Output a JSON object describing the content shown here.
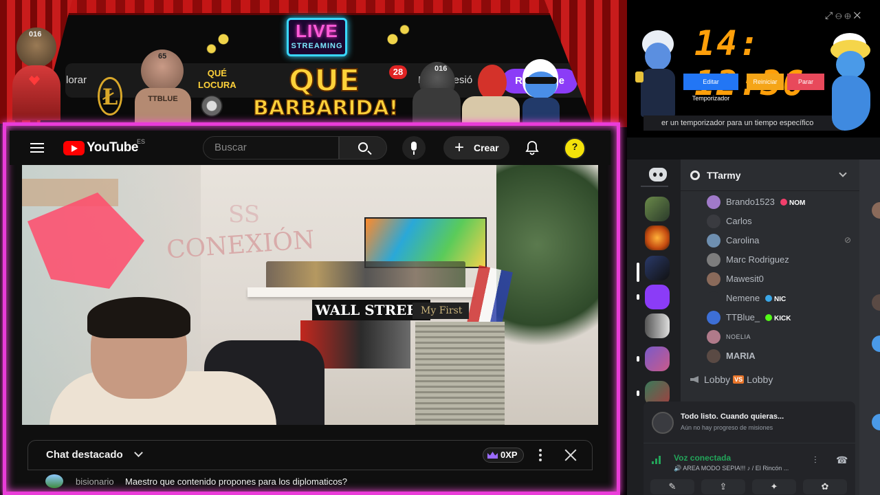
{
  "overlay": {
    "live_line1": "LIVE",
    "live_line2": "STREAMING",
    "que_locura_1": "QUÉ",
    "que_locura_2": "LOCURA",
    "headline_1": "QUE",
    "headline_2": "BARBARIDA!",
    "cat_label": "016",
    "man_label": "65",
    "man_shirt": "TTBLUE",
    "robot_label": "016",
    "ghost_explore": "lorar",
    "ghost_signin": "Iniciar sesió",
    "ghost_signin2": "Re",
    "ghost_signin3": "se",
    "notification_count": "28",
    "theme_color": "#e93cd8"
  },
  "youtube": {
    "logo_text": "YouTube",
    "region": "ES",
    "search_placeholder": "Buscar",
    "create_label": "Crear",
    "menu_icon": "hamburger-icon",
    "search_icon": "search-icon",
    "mic_icon": "mic-icon",
    "bell_icon": "bell-icon",
    "video": {
      "wall_text_1": "SS",
      "wall_text_2": "CONEXIÓN",
      "sign_1": "WALL STREET",
      "sign_2": "My First"
    },
    "chat": {
      "title": "Chat destacado",
      "xp": "0XP",
      "messages": [
        {
          "user": "bisionario",
          "text": "Maestro que contenido propones para los diplomaticos?"
        }
      ]
    }
  },
  "timer": {
    "time": "14: 12:36",
    "buttons": {
      "edit": "Editar Temporizador",
      "reset": "Reiniciar",
      "stop": "Parar"
    },
    "hint": "er un temporizador para un tiempo específico",
    "top_icons": "⤢⊖⊕✕"
  },
  "discord": {
    "server_name": "TTarmy",
    "members": [
      {
        "name": "Brando1523",
        "tag": "NOM",
        "tag_color": "#f23f6b",
        "avatar": "#a07ac9"
      },
      {
        "name": "Carlos",
        "avatar": "#3a3b40"
      },
      {
        "name": "Carolina",
        "avatar": "#6e8fb0",
        "muted": true
      },
      {
        "name": "Marc Rodriguez",
        "avatar": "#7d7d7d"
      },
      {
        "name": "Mawesit0",
        "avatar": "#8a6a5a"
      },
      {
        "name": "Nemene",
        "tag": "NIC",
        "tag_color": "#3aa7e8",
        "avatar": "#2b2d31"
      },
      {
        "name": "TTBlue_",
        "tag": "KICK",
        "tag_color": "#53fc18",
        "avatar": "#3d6fd6"
      },
      {
        "name": "NOELIA",
        "avatar": "#b07a8a"
      },
      {
        "name": "MARIA",
        "avatar": "#5a4a44"
      }
    ],
    "lobby_left": "Lobby",
    "lobby_vs": "VS",
    "lobby_right": "Lobby",
    "quest": {
      "title": "Todo listo. Cuando quieras...",
      "subtitle": "Aún no hay progreso de misiones"
    },
    "voice": {
      "status": "Voz conectada",
      "channel": "🔊 AREA MODO SEPIA!!! ♪ / El Rincón ...",
      "buttons": [
        "✎",
        "⇪",
        "✦",
        "✿"
      ]
    }
  }
}
